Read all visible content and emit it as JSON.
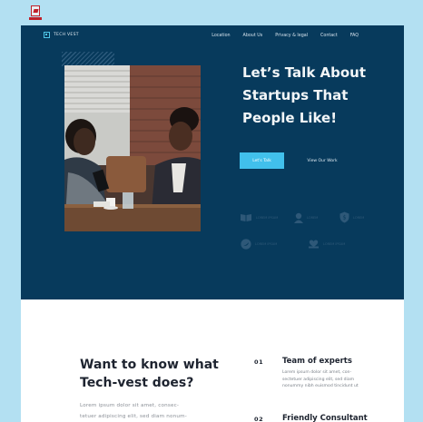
{
  "nav": {
    "brand": "TECH VEST",
    "links": [
      "Location",
      "About Us",
      "Privacy & legal",
      "Contact",
      "FAQ"
    ]
  },
  "hero": {
    "title_lines": [
      "Let’s Talk About",
      "Startups That",
      "People Like!"
    ],
    "primary_button": "Let's Talk",
    "secondary_button": "View Our Work"
  },
  "features": [
    {
      "icon": "book-icon",
      "label": "LOREM IPSUM"
    },
    {
      "icon": "user-icon",
      "label": "LOREM"
    },
    {
      "icon": "shield-icon",
      "label": "LOREM"
    },
    {
      "icon": "bird-icon",
      "label": "LOREM IPSUM"
    },
    {
      "icon": "heart-hands-icon",
      "label": "LOREM IPSUM"
    }
  ],
  "about": {
    "title_lines": [
      "Want to know what",
      "Tech-vest does?"
    ],
    "text_lines": [
      "Lorem ipsum dolor sit amet, consec-",
      "tetuer adipiscing elit, sed diam nonum-"
    ]
  },
  "items": [
    {
      "num": "01",
      "title": "Team of experts",
      "desc": [
        "Lorem ipsum dolor sit amet, con-",
        "sectetuer adipiscing elit, sed diam",
        "nonummy nibh euismod tincidunt ut"
      ]
    },
    {
      "num": "02",
      "title": "Friendly Consultant",
      "desc": []
    }
  ],
  "colors": {
    "page_bg": "#b3e0f2",
    "hero_bg": "#073a5c",
    "accent": "#41c0ec",
    "text_dark": "#1e2430"
  }
}
